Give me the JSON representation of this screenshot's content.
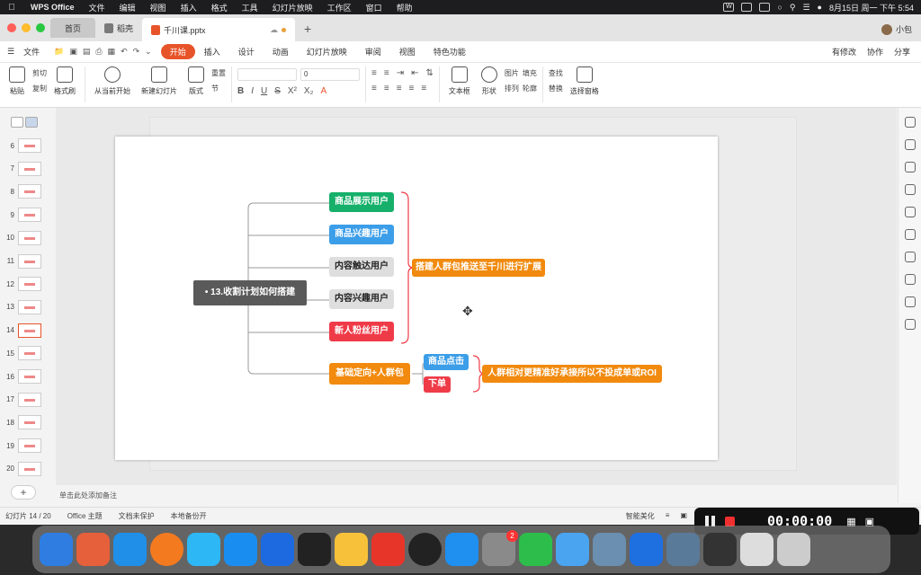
{
  "menubar": {
    "app": "WPS Office",
    "items": [
      "文件",
      "编辑",
      "视图",
      "插入",
      "格式",
      "工具",
      "幻灯片放映",
      "工作区",
      "窗口",
      "帮助"
    ],
    "datetime": "8月15日 周一 下午 5:54"
  },
  "tabs": {
    "home": "首页",
    "daoke": "稻壳",
    "file": "千川课.pptx",
    "user": "小包"
  },
  "ribbon_menu": {
    "file": "文件",
    "items": [
      "开始",
      "插入",
      "设计",
      "动画",
      "幻灯片放映",
      "审阅",
      "视图",
      "特色功能"
    ],
    "right": [
      "有修改",
      "协作",
      "分享"
    ]
  },
  "toolbar": {
    "paste": "粘贴",
    "cut": "剪切",
    "copy": "复制",
    "format_painter": "格式刷",
    "play_from": "从当前开始",
    "new_slide": "新建幻灯片",
    "layout": "版式",
    "reset": "重置",
    "section": "节",
    "font_size": "0",
    "text_box": "文本框",
    "shape": "形状",
    "picture": "图片",
    "arrange": "排列",
    "fill": "填充",
    "outline": "轮廓",
    "find": "查找",
    "replace": "替换",
    "select_pane": "选择窗格"
  },
  "thumbnails": [
    {
      "num": "6"
    },
    {
      "num": "7"
    },
    {
      "num": "8"
    },
    {
      "num": "9"
    },
    {
      "num": "10"
    },
    {
      "num": "11"
    },
    {
      "num": "12"
    },
    {
      "num": "13"
    },
    {
      "num": "14"
    },
    {
      "num": "15"
    },
    {
      "num": "16"
    },
    {
      "num": "17"
    },
    {
      "num": "18"
    },
    {
      "num": "19"
    },
    {
      "num": "20"
    }
  ],
  "mindmap": {
    "root": "13.收割计划如何搭建",
    "branches": [
      "商品展示用户",
      "商品兴趣用户",
      "内容触达用户",
      "内容兴趣用户",
      "新人粉丝用户"
    ],
    "group_summary": "搭建人群包推送至千川进行扩展",
    "second": "基础定向+人群包",
    "sub": [
      "商品点击",
      "下单"
    ],
    "sub_summary": "人群相对更精准好承接所以不投成单或ROI"
  },
  "notes_placeholder": "单击此处添加备注",
  "status": {
    "slide": "幻灯片 14 / 20",
    "theme": "Office 主题",
    "protect": "文档未保护",
    "backup": "本地备份开",
    "beautify": "智能美化"
  },
  "recording": {
    "time": "00:00:00"
  },
  "dock_badge": "2"
}
